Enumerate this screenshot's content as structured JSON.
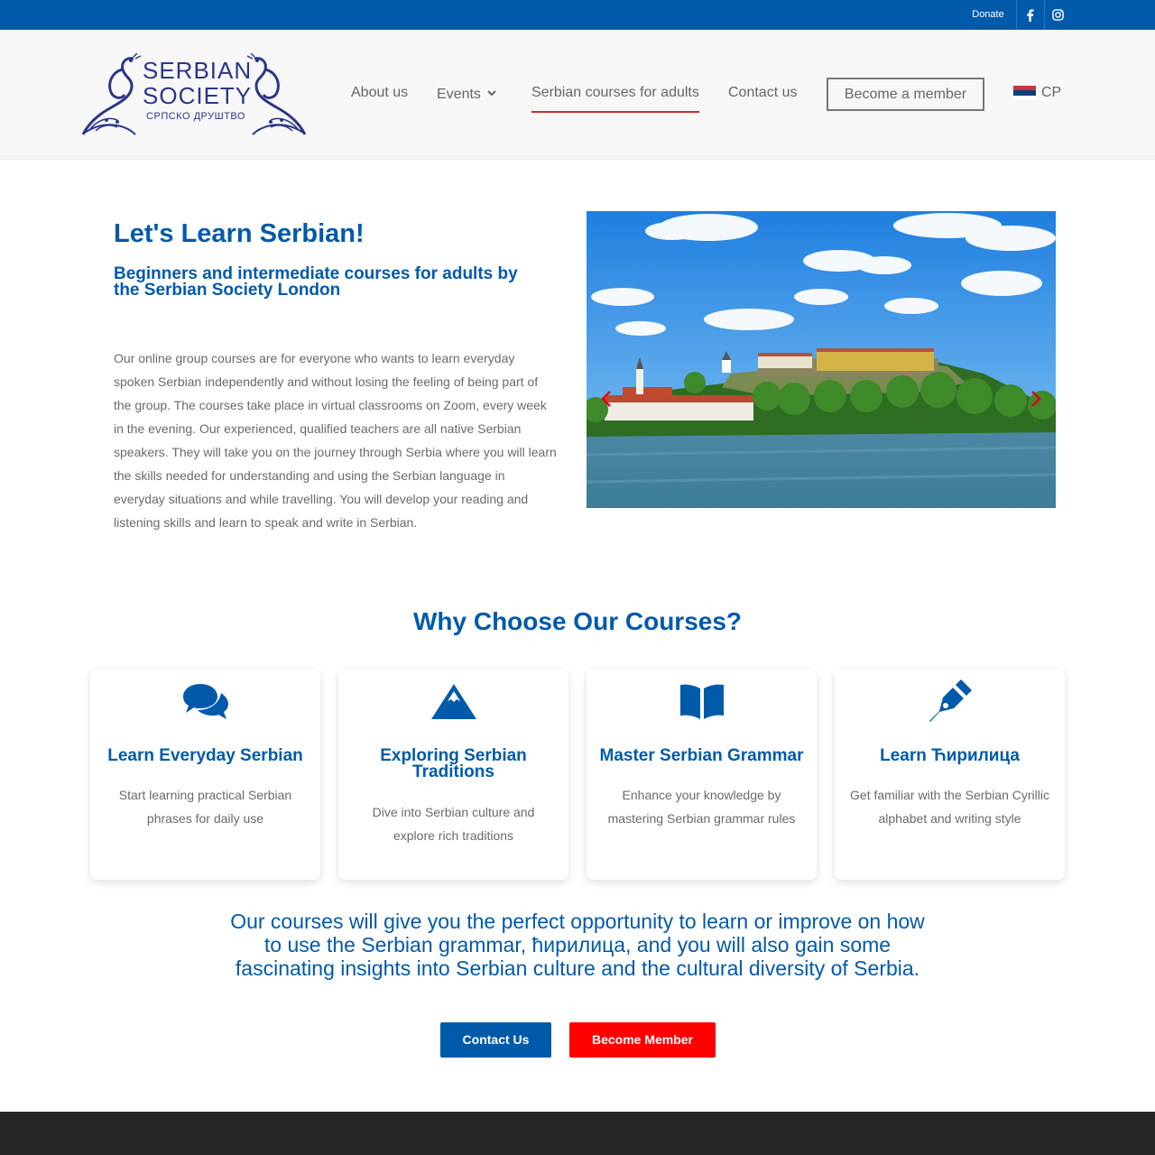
{
  "topbar": {
    "donate_label": "Donate",
    "social_icons": [
      "facebook-icon",
      "instagram-icon"
    ]
  },
  "logo": {
    "line1": "SERBIAN",
    "line2": "SOCIETY",
    "line3": "СРПСКО ДРУШТВО"
  },
  "nav": {
    "items": [
      {
        "label": "About us"
      },
      {
        "label": "Events"
      },
      {
        "label": "Serbian courses for adults",
        "active": true
      },
      {
        "label": "Contact us"
      }
    ],
    "member_button": "Become a member",
    "language": "CP"
  },
  "hero": {
    "title": "Let's Learn Serbian!",
    "subtitle": "Beginners and intermediate courses for adults by the Serbian Society London",
    "body": "Our online group courses are for everyone who wants to learn everyday spoken Serbian independently and without losing the feeling of being part of the group. The courses take place in virtual classrooms on Zoom, every week in the evening. Our experienced, qualified teachers are all native Serbian speakers. They will take you on the journey through Serbia where you will learn the skills needed for understanding and using the Serbian language in everyday situations and while travelling. You will develop your reading and listening skills and learn to speak and write in Serbian."
  },
  "why": {
    "title": "Why Choose Our Courses?",
    "cards": [
      {
        "icon": "chat-bubbles-icon",
        "title": "Learn Everyday Serbian",
        "text": "Start learning practical Serbian phrases for daily use"
      },
      {
        "icon": "mountain-icon",
        "title": "Exploring Serbian Traditions",
        "text": "Dive into Serbian culture and explore rich traditions"
      },
      {
        "icon": "open-book-icon",
        "title": "Master Serbian Grammar",
        "text": "Enhance your knowledge by mastering Serbian grammar rules"
      },
      {
        "icon": "pen-nib-icon",
        "title": "Learn Ћирилица",
        "text": "Get familiar with the Serbian Cyrillic alphabet and writing style"
      }
    ]
  },
  "closing": {
    "text": "Our courses will give you the perfect opportunity to learn or improve on how to use the Serbian grammar, ћирилица, and you will also gain some fascinating insights into Serbian culture and the cultural diversity of Serbia.",
    "contact_button": "Contact Us",
    "member_button": "Become Member"
  },
  "colors": {
    "brand_blue": "#005aaa",
    "accent_red": "#ff0000",
    "nav_underline": "#d22b2b",
    "footer": "#262626"
  }
}
